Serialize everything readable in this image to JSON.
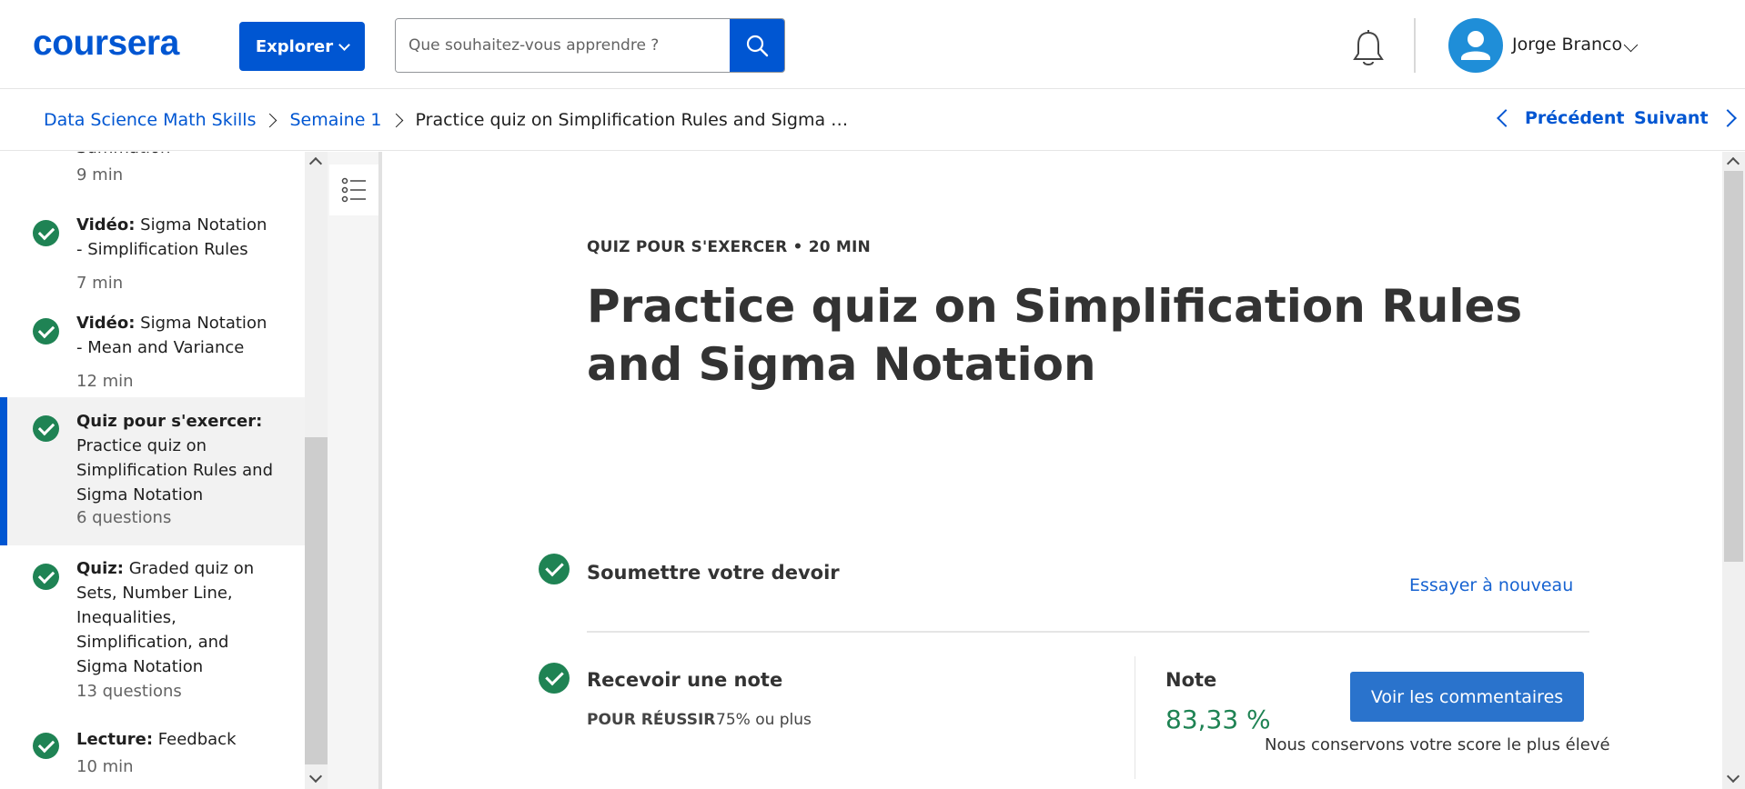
{
  "header": {
    "logo": "coursera",
    "explore_label": "Explorer",
    "search_placeholder": "Que souhaitez-vous apprendre ?",
    "user_name": "Jorge Branco",
    "brand_color": "#0056d2"
  },
  "breadcrumb": {
    "items": [
      "Data Science Math Skills",
      "Semaine 1",
      "Practice quiz on Simplification Rules and Sigma …"
    ],
    "prev_label": "Précédent",
    "next_label": "Suivant"
  },
  "sidebar": {
    "items": [
      {
        "type": "",
        "title": "Summation",
        "meta": "9 min",
        "completed": true
      },
      {
        "type": "Vidéo:",
        "title": " Sigma Notation - Simplification Rules",
        "meta": "7 min",
        "completed": true
      },
      {
        "type": "Vidéo:",
        "title": " Sigma Notation - Mean and Variance",
        "meta": "12 min",
        "completed": true
      },
      {
        "type": "Quiz pour s'exercer:",
        "title": " Practice quiz on Simplification Rules and Sigma Notation",
        "meta": "6 questions",
        "completed": true,
        "active": true
      },
      {
        "type": "Quiz:",
        "title": " Graded quiz on Sets, Number Line, Inequalities, Simplification, and Sigma Notation",
        "meta": "13 questions",
        "completed": true
      },
      {
        "type": "Lecture:",
        "title": " Feedback",
        "meta": "10 min",
        "completed": true
      }
    ]
  },
  "main": {
    "eyebrow": "QUIZ POUR S'EXERCER • 20 MIN",
    "title": "Practice quiz on Simplification Rules and Sigma Notation",
    "submit_title": "Soumettre votre devoir",
    "retry_label": "Essayer à nouveau",
    "grade_title": "Recevoir une note",
    "pass_label": "POUR RÉUSSIR",
    "pass_value": "75% ou plus",
    "note_label": "Note",
    "note_value": "83,33 %",
    "feedback_button": "Voir les commentaires",
    "keep_note": "Nous conservons votre score le plus élevé",
    "success_color": "#1f8354"
  }
}
